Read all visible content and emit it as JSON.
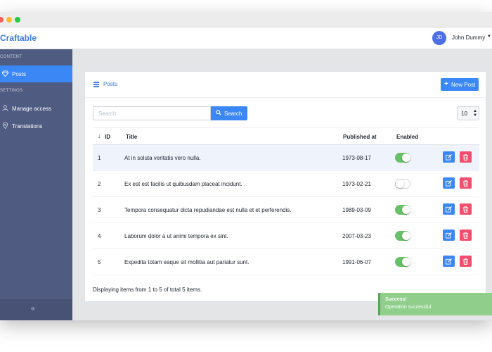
{
  "app": {
    "brand": "Craftable"
  },
  "user": {
    "initials": "JD",
    "name": "John Dummy"
  },
  "sidebar": {
    "sections": [
      {
        "title": "CONTENT",
        "items": [
          {
            "label": "Posts",
            "icon": "diamond-icon",
            "active": true
          }
        ]
      },
      {
        "title": "SETTINGS",
        "items": [
          {
            "label": "Manage access",
            "icon": "user-icon"
          },
          {
            "label": "Translations",
            "icon": "location-icon"
          }
        ]
      }
    ],
    "collapse_glyph": "«"
  },
  "card": {
    "title": "Posts",
    "new_button": "New Post",
    "search": {
      "placeholder": "Search",
      "value": "",
      "button": "Search"
    },
    "per_page": "10"
  },
  "table": {
    "columns": [
      "ID",
      "Title",
      "Published at",
      "Enabled"
    ],
    "rows": [
      {
        "id": "1",
        "title": "At in soluta veritatis vero nulla.",
        "published": "1973-08-17",
        "enabled": true
      },
      {
        "id": "2",
        "title": "Ex est est facilis ut quibusdam placeat incidunt.",
        "published": "1973-02-21",
        "enabled": false
      },
      {
        "id": "3",
        "title": "Tempora consequatur dicta repudiandae est nulla et et perferendis.",
        "published": "1989-03-09",
        "enabled": true
      },
      {
        "id": "4",
        "title": "Laborum dolor a ut animi tempora ex sint.",
        "published": "2007-03-23",
        "enabled": true
      },
      {
        "id": "5",
        "title": "Expedita totam eaque sit mollitia aut pariatur sunt.",
        "published": "1991-06-07",
        "enabled": true
      }
    ]
  },
  "footer": {
    "summary": "Displaying items from 1 to 5 of total 5 items."
  },
  "toast": {
    "title": "Success!",
    "message": "Operation successful"
  },
  "colors": {
    "primary": "#3b87f5",
    "sidebar": "#4f5b80",
    "success": "#6ac06a",
    "danger": "#f0506e"
  }
}
